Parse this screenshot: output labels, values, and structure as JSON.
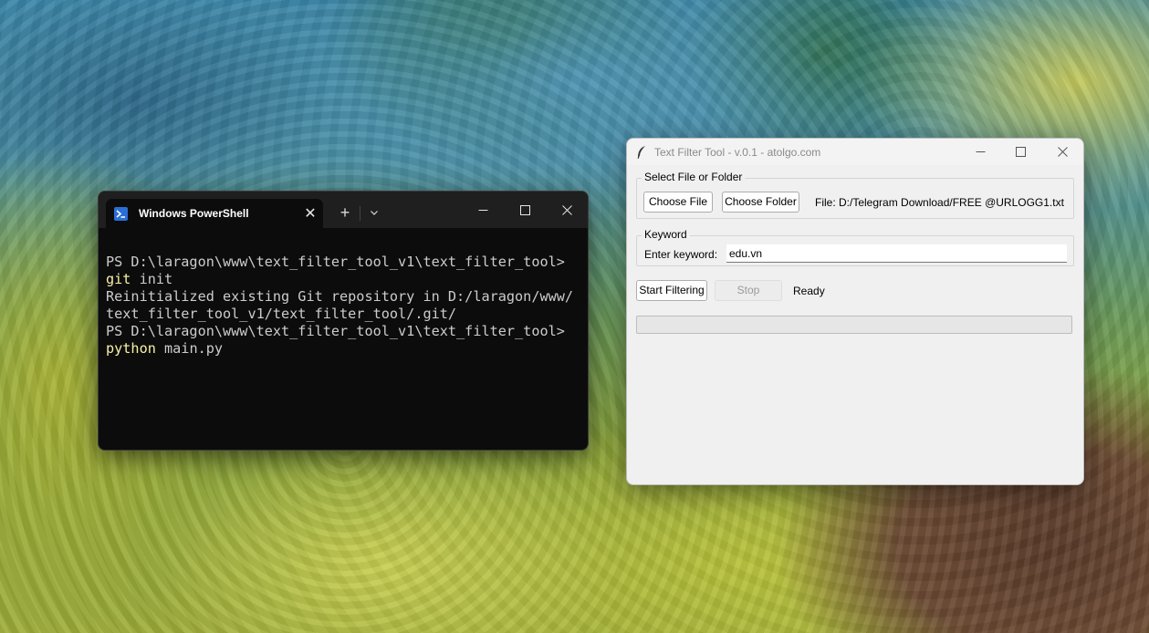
{
  "powershell": {
    "tab_title": "Windows PowerShell",
    "close_glyph": "✕",
    "new_tab_glyph": "+",
    "dropdown_glyph": "⌄",
    "lines": [
      {
        "prompt": "PS D:\\laragon\\www\\text_filter_tool_v1\\text_filter_tool>",
        "cmd_keyword": "",
        "cmd_rest": ""
      },
      {
        "prompt": "",
        "cmd_keyword": "git",
        "cmd_rest": " init"
      },
      {
        "prompt": "Reinitialized existing Git repository in D:/laragon/www/",
        "cmd_keyword": "",
        "cmd_rest": ""
      },
      {
        "prompt": "text_filter_tool_v1/text_filter_tool/.git/",
        "cmd_keyword": "",
        "cmd_rest": ""
      },
      {
        "prompt": "PS D:\\laragon\\www\\text_filter_tool_v1\\text_filter_tool>",
        "cmd_keyword": "",
        "cmd_rest": ""
      },
      {
        "prompt": "",
        "cmd_keyword": "python",
        "cmd_rest": " main.py"
      }
    ],
    "icon": "powershell-icon",
    "accent_color": "#f9f1a5"
  },
  "text_filter": {
    "title": "Text Filter Tool - v.0.1 - atolgo.com",
    "icon": "feather-icon",
    "select_group": {
      "legend": "Select File or Folder",
      "choose_file": "Choose File",
      "choose_folder": "Choose Folder",
      "file_label": "File: D:/Telegram Download/FREE @URLOGG1.txt"
    },
    "keyword_group": {
      "legend": "Keyword",
      "enter_label": "Enter keyword:",
      "value": "edu.vn"
    },
    "actions": {
      "start": "Start Filtering",
      "stop": "Stop",
      "status": "Ready"
    },
    "progress": 0
  }
}
